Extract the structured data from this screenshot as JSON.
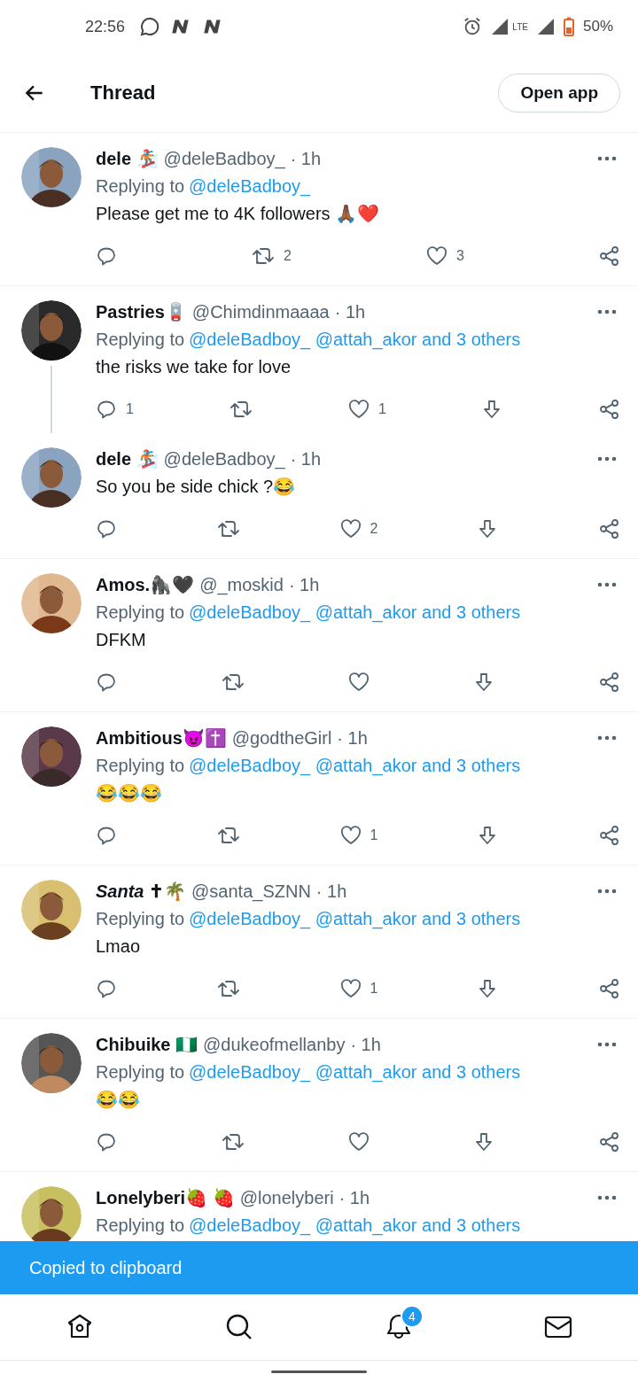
{
  "status_bar": {
    "time": "22:56",
    "network": "LTE",
    "battery": "50%"
  },
  "header": {
    "title": "Thread",
    "button": "Open app"
  },
  "tweets": [
    {
      "name": "dele 🏂",
      "handle": "@deleBadboy_",
      "time": "· 1h",
      "replying_label": "Replying to",
      "replying_to": "@deleBadboy_",
      "body": "Please get me to 4K followers 🙏🏾❤️",
      "thread_continues": false,
      "actions": [
        {
          "kind": "reply"
        },
        {
          "kind": "retweet",
          "count": "2"
        },
        {
          "kind": "like",
          "count": "3"
        },
        {
          "kind": "share"
        }
      ]
    },
    {
      "name": "Pastries🪫",
      "handle": "@Chimdinmaaaa",
      "time": "· 1h",
      "replying_label": "Replying to",
      "replying_to": "@deleBadboy_ @attah_akor and 3 others",
      "body": "the risks we take for love",
      "thread_continues": true,
      "actions": [
        {
          "kind": "reply",
          "count": "1"
        },
        {
          "kind": "retweet"
        },
        {
          "kind": "like",
          "count": "1"
        },
        {
          "kind": "download"
        },
        {
          "kind": "share"
        }
      ]
    },
    {
      "name": "dele 🏂",
      "handle": "@deleBadboy_",
      "time": "· 1h",
      "body": "So you be side chick ?😂",
      "thread_continues": false,
      "actions": [
        {
          "kind": "reply"
        },
        {
          "kind": "retweet"
        },
        {
          "kind": "like",
          "count": "2"
        },
        {
          "kind": "download"
        },
        {
          "kind": "share"
        }
      ]
    },
    {
      "name": "Amos.🦍🖤",
      "handle": "@_moskid",
      "time": "· 1h",
      "replying_label": "Replying to",
      "replying_to": "@deleBadboy_ @attah_akor and 3 others",
      "body": "DFKM",
      "thread_continues": false,
      "actions": [
        {
          "kind": "reply"
        },
        {
          "kind": "retweet"
        },
        {
          "kind": "like"
        },
        {
          "kind": "download"
        },
        {
          "kind": "share"
        }
      ]
    },
    {
      "name": "Ambitious😈✝️",
      "handle": "@godtheGirl",
      "time": "· 1h",
      "replying_label": "Replying to",
      "replying_to": "@deleBadboy_ @attah_akor and 3 others",
      "body": "😂😂😂",
      "thread_continues": false,
      "actions": [
        {
          "kind": "reply"
        },
        {
          "kind": "retweet"
        },
        {
          "kind": "like",
          "count": "1"
        },
        {
          "kind": "download"
        },
        {
          "kind": "share"
        }
      ]
    },
    {
      "name": "*Santa* ✝🌴",
      "handle": "@santa_SZNN",
      "time": "· 1h",
      "replying_label": "Replying to",
      "replying_to": "@deleBadboy_ @attah_akor and 3 others",
      "body": "Lmao",
      "thread_continues": false,
      "actions": [
        {
          "kind": "reply"
        },
        {
          "kind": "retweet"
        },
        {
          "kind": "like",
          "count": "1"
        },
        {
          "kind": "download"
        },
        {
          "kind": "share"
        }
      ]
    },
    {
      "name": "Chibuike 🇳🇬",
      "handle": "@dukeofmellanby",
      "time": "· 1h",
      "replying_label": "Replying to",
      "replying_to": "@deleBadboy_ @attah_akor and 3 others",
      "body": "😂😂",
      "thread_continues": false,
      "actions": [
        {
          "kind": "reply"
        },
        {
          "kind": "retweet"
        },
        {
          "kind": "like"
        },
        {
          "kind": "download"
        },
        {
          "kind": "share"
        }
      ]
    },
    {
      "name": "Lonelyberi🍓 🍓",
      "handle": "@lonelyberi",
      "time": "· 1h",
      "replying_label": "Replying to",
      "replying_to": "@deleBadboy_ @attah_akor and 3 others",
      "thread_continues": false
    }
  ],
  "toast": "Copied to clipboard",
  "bottom_nav": [
    {
      "kind": "home"
    },
    {
      "kind": "search"
    },
    {
      "kind": "notifications",
      "badge": "4"
    },
    {
      "kind": "messages"
    }
  ]
}
